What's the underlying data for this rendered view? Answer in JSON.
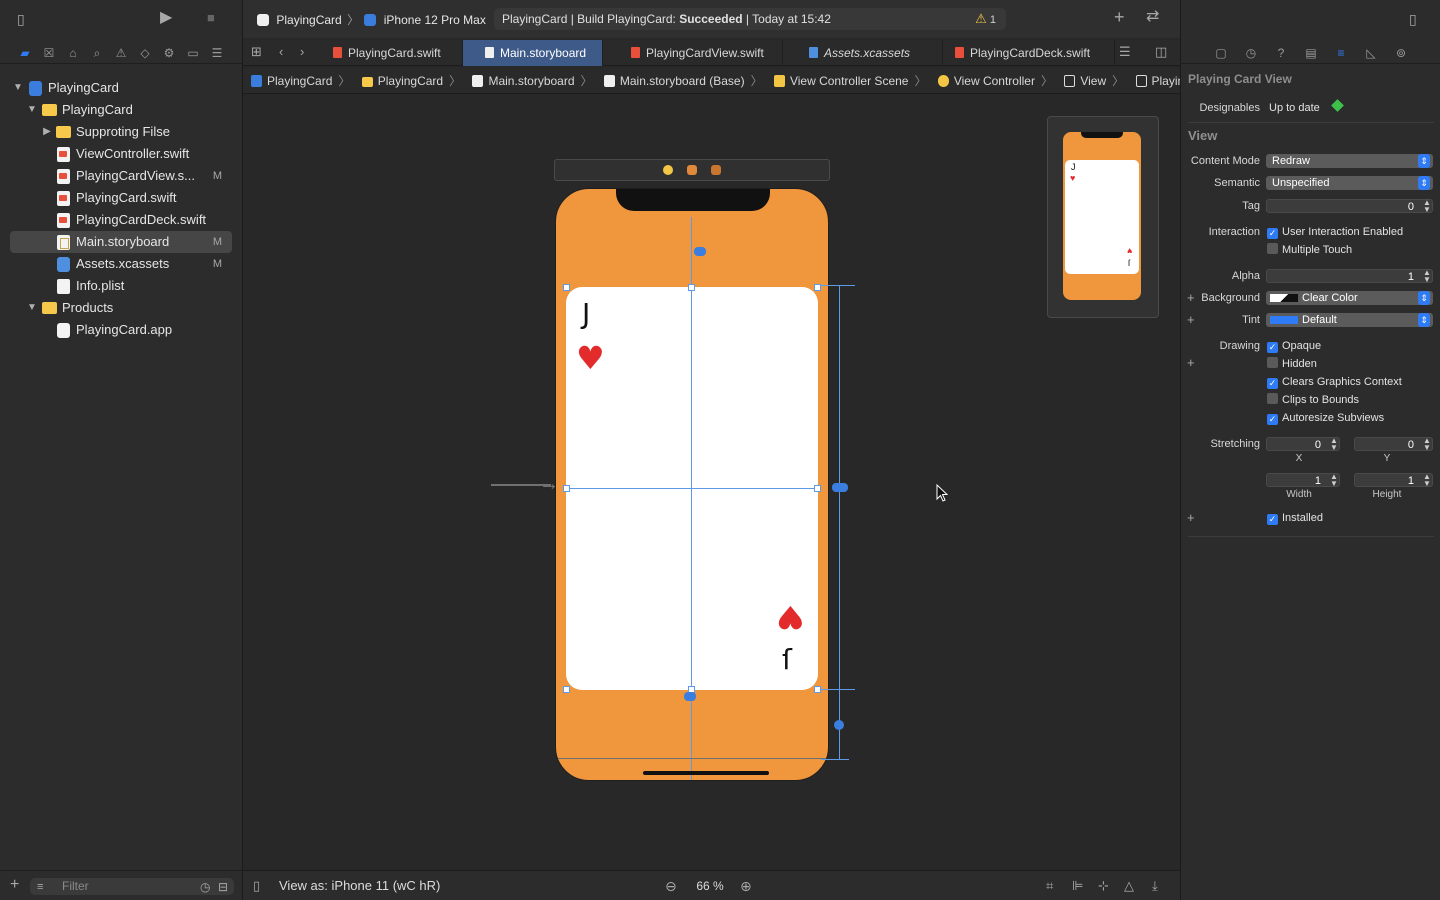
{
  "toolbar": {
    "scheme_target": "PlayingCard",
    "scheme_device": "iPhone 12 Pro Max",
    "activity_prefix": "PlayingCard | Build PlayingCard: ",
    "activity_status": "Succeeded",
    "activity_suffix": " | Today at 15:42",
    "warning_count": "1"
  },
  "navigator": {
    "items": [
      {
        "label": "PlayingCard",
        "badge": ""
      },
      {
        "label": "PlayingCard",
        "badge": ""
      },
      {
        "label": "Supproting Filse",
        "badge": ""
      },
      {
        "label": "ViewController.swift",
        "badge": ""
      },
      {
        "label": "PlayingCardView.s...",
        "badge": "M"
      },
      {
        "label": "PlayingCard.swift",
        "badge": ""
      },
      {
        "label": "PlayingCardDeck.swift",
        "badge": ""
      },
      {
        "label": "Main.storyboard",
        "badge": "M"
      },
      {
        "label": "Assets.xcassets",
        "badge": "M"
      },
      {
        "label": "Info.plist",
        "badge": ""
      },
      {
        "label": "Products",
        "badge": ""
      },
      {
        "label": "PlayingCard.app",
        "badge": ""
      }
    ],
    "filter_placeholder": "Filter"
  },
  "editor_tabs": [
    {
      "label": "PlayingCard.swift"
    },
    {
      "label": "Main.storyboard"
    },
    {
      "label": "PlayingCardView.swift"
    },
    {
      "label": "Assets.xcassets"
    },
    {
      "label": "PlayingCardDeck.swift"
    }
  ],
  "jumpbar": {
    "crumbs": [
      "PlayingCard",
      "PlayingCard",
      "Main.storyboard",
      "Main.storyboard (Base)",
      "View Controller Scene",
      "View Controller",
      "View",
      "Playing Card View"
    ]
  },
  "canvas": {
    "card_rank": "J",
    "card_suit": "♥",
    "card_rank_bottom": "ſ",
    "mini_rank": "J",
    "mini_rank_bottom": "ſ"
  },
  "canvas_footer": {
    "view_as": "View as: iPhone 11 (wC hR)",
    "zoom": "66 %"
  },
  "inspector": {
    "title": "Playing Card View",
    "designables_label": "Designables",
    "designables_value": "Up to date",
    "view_section": "View",
    "content_mode_label": "Content Mode",
    "content_mode": "Redraw",
    "semantic_label": "Semantic",
    "semantic": "Unspecified",
    "tag_label": "Tag",
    "tag": "0",
    "interaction_label": "Interaction",
    "user_interaction": "User Interaction Enabled",
    "multiple_touch": "Multiple Touch",
    "alpha_label": "Alpha",
    "alpha": "1",
    "background_label": "Background",
    "background": "Clear Color",
    "tint_label": "Tint",
    "tint": "Default",
    "drawing_label": "Drawing",
    "opaque": "Opaque",
    "hidden": "Hidden",
    "clears_context": "Clears Graphics Context",
    "clips_to_bounds": "Clips to Bounds",
    "autoresize": "Autoresize Subviews",
    "stretching_label": "Stretching",
    "stretch_x": "0",
    "stretch_y": "0",
    "stretch_w": "1",
    "stretch_h": "1",
    "x_label": "X",
    "y_label": "Y",
    "width_label": "Width",
    "height_label": "Height",
    "installed": "Installed"
  },
  "colors": {
    "accent": "#2f7bf5",
    "phone_background": "#f0963c",
    "suit_red": "#e32b2b",
    "selected_tab": "#3d5a89"
  }
}
